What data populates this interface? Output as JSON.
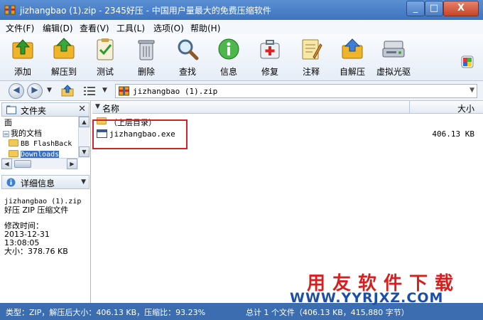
{
  "window": {
    "title": "jizhangbao (1).zip - 2345好压 - 中国用户量最大的免费压缩软件"
  },
  "menu": [
    "文件(F)",
    "编辑(D)",
    "查看(V)",
    "工具(L)",
    "选项(O)",
    "帮助(H)"
  ],
  "toolbar": {
    "add": "添加",
    "extract_to": "解压到",
    "test": "测试",
    "delete": "删除",
    "find": "查找",
    "info": "信息",
    "repair": "修复",
    "comment": "注释",
    "self_extract": "自解压",
    "virtual_drive": "虚拟光驱"
  },
  "address": {
    "path": "jizhangbao (1).zip"
  },
  "left_panel": {
    "folders_title": "文件夹",
    "tree": [
      "面",
      "我的文档",
      "BB FlashBack",
      "Downloads"
    ],
    "details_title": "详细信息",
    "details": {
      "filename": "jizhangbao (1).zip",
      "filetype": "好压 ZIP 压缩文件",
      "modified_label": "修改时间：",
      "modified_date": "2013-12-31",
      "modified_time": "13:08:05",
      "size": "大小：378.76 KB"
    }
  },
  "file_list": {
    "col_name": "名称",
    "col_size": "大小",
    "rows": [
      {
        "name": "（上层目录）",
        "size": ""
      },
      {
        "name": "jizhangbao.exe",
        "size": "406.13 KB"
      }
    ]
  },
  "status": {
    "left": "类型：ZIP，解压后大小：406.13 KB，压缩比：93.23%",
    "right": "总计 1 个文件（406.13 KB，415,880 字节）"
  },
  "watermark": {
    "cn": "用友软件下载",
    "url": "WWW.YYRJXZ.COM"
  },
  "colors": {
    "title_bar": "#3e74bf",
    "status_bar": "#3c6db0",
    "highlight_box": "#d2232a",
    "watermark_red": "#d81f1f",
    "watermark_blue": "#1b4ea8"
  }
}
